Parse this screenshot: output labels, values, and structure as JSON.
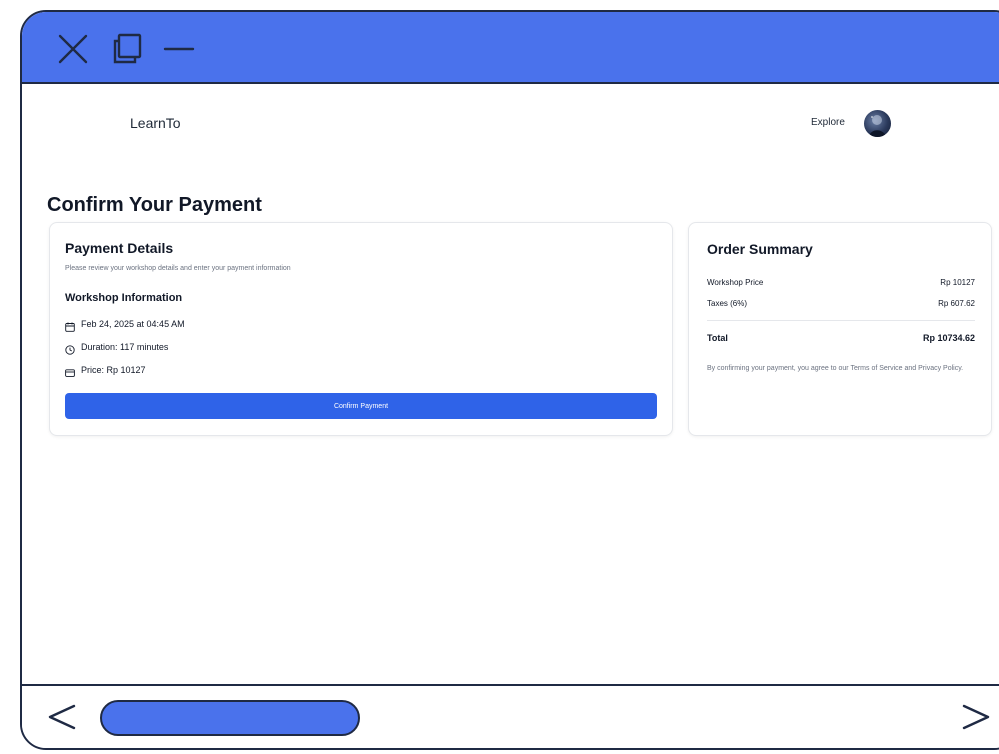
{
  "window": {
    "controls": {
      "close": "close-icon",
      "maximize": "maximize-icon",
      "minimize": "minimize-icon"
    },
    "accent_color": "#4a72ec",
    "border_color": "#1f2a44"
  },
  "header": {
    "brand": "LearnTo",
    "nav_explore": "Explore",
    "avatar": "user-avatar"
  },
  "page": {
    "title": "Confirm Your Payment"
  },
  "payment_details": {
    "title": "Payment Details",
    "subtitle": "Please review your workshop details and enter your payment information",
    "section_title": "Workshop Information",
    "date": "Feb 24, 2025 at 04:45 AM",
    "duration": "Duration: 117 minutes",
    "price": "Price: Rp 10127",
    "confirm_label": "Confirm Payment",
    "button_color": "#2f63e8"
  },
  "order_summary": {
    "title": "Order Summary",
    "rows": [
      {
        "label": "Workshop Price",
        "value": "Rp 10127"
      },
      {
        "label": "Taxes (6%)",
        "value": "Rp 607.62"
      }
    ],
    "total_label": "Total",
    "total_value": "Rp 10734.62",
    "terms": "By confirming your payment, you agree to our Terms of Service and Privacy Policy."
  },
  "bottom_nav": {
    "back": "chevron-left-icon",
    "forward": "chevron-right-icon"
  }
}
